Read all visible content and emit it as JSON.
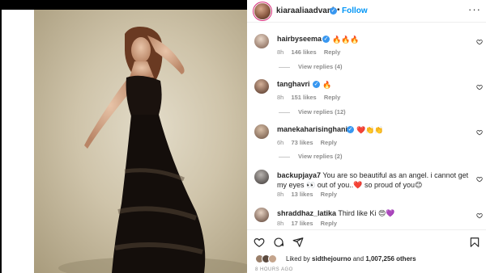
{
  "post": {
    "username": "kiaraaliaadvani",
    "separator": "•",
    "follow_label": "Follow",
    "more_label": "···"
  },
  "comments": [
    {
      "username": "hairbyseema",
      "text": "🔥🔥🔥",
      "time": "8h",
      "likes": "146 likes",
      "reply_label": "Reply",
      "view_replies": "View replies (4)",
      "verified": true
    },
    {
      "username": "tanghavri",
      "text": "🔥",
      "time": "8h",
      "likes": "151 likes",
      "reply_label": "Reply",
      "view_replies": "View replies (12)",
      "verified": true
    },
    {
      "username": "manekaharisinghani",
      "text": "❤️👏👏",
      "time": "6h",
      "likes": "73 likes",
      "reply_label": "Reply",
      "view_replies": "View replies (2)",
      "verified": true
    },
    {
      "username": "backupjaya7",
      "text": "You are so beautiful as an angel. i cannot get my eyes 👀 out of you..❤️ so proud of you😊",
      "time": "8h",
      "likes": "13 likes",
      "reply_label": "Reply",
      "verified": false
    },
    {
      "username": "shraddhaz_latika",
      "text": "Third like Ki 😍💜",
      "time": "8h",
      "likes": "17 likes",
      "reply_label": "Reply",
      "verified": false
    }
  ],
  "likes": {
    "prefix": "Liked by",
    "user": "sidthejourno",
    "and": "and",
    "count": "1,007,256 others"
  },
  "timestamp": "8 HOURS AGO",
  "icons": {
    "like": "heart-icon",
    "comment": "comment-icon",
    "share": "share-icon",
    "save": "bookmark-icon",
    "verified": "verified-badge-icon",
    "more": "more-options-icon"
  },
  "colors": {
    "follow": "#0095f6",
    "verified": "#3897f0",
    "meta_text": "#8e8e8e",
    "primary_text": "#262626"
  }
}
